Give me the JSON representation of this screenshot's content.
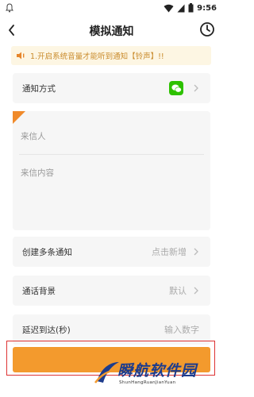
{
  "status_bar": {
    "time": "9:56"
  },
  "header": {
    "title": "模拟通知"
  },
  "notice": {
    "text": "1.开启系统音量才能听到通知【铃声】!!"
  },
  "notify_method": {
    "label": "通知方式"
  },
  "message": {
    "sender_placeholder": "来信人",
    "content_placeholder": "来信内容"
  },
  "multi_notify": {
    "label": "创建多条通知",
    "value": "点击新增"
  },
  "call_background": {
    "label": "通话背景",
    "value": "默认"
  },
  "delay": {
    "label": "延迟到达(秒)",
    "placeholder": "输入数字"
  },
  "watermark": {
    "brand": "瞬航软件园",
    "brand_en": "ShunHangRuanJianYuan"
  },
  "colors": {
    "accent": "#f39a2d",
    "wechat": "#2dc100",
    "notice_bg": "#fdf6e3",
    "notice_text": "#c98a2a"
  }
}
